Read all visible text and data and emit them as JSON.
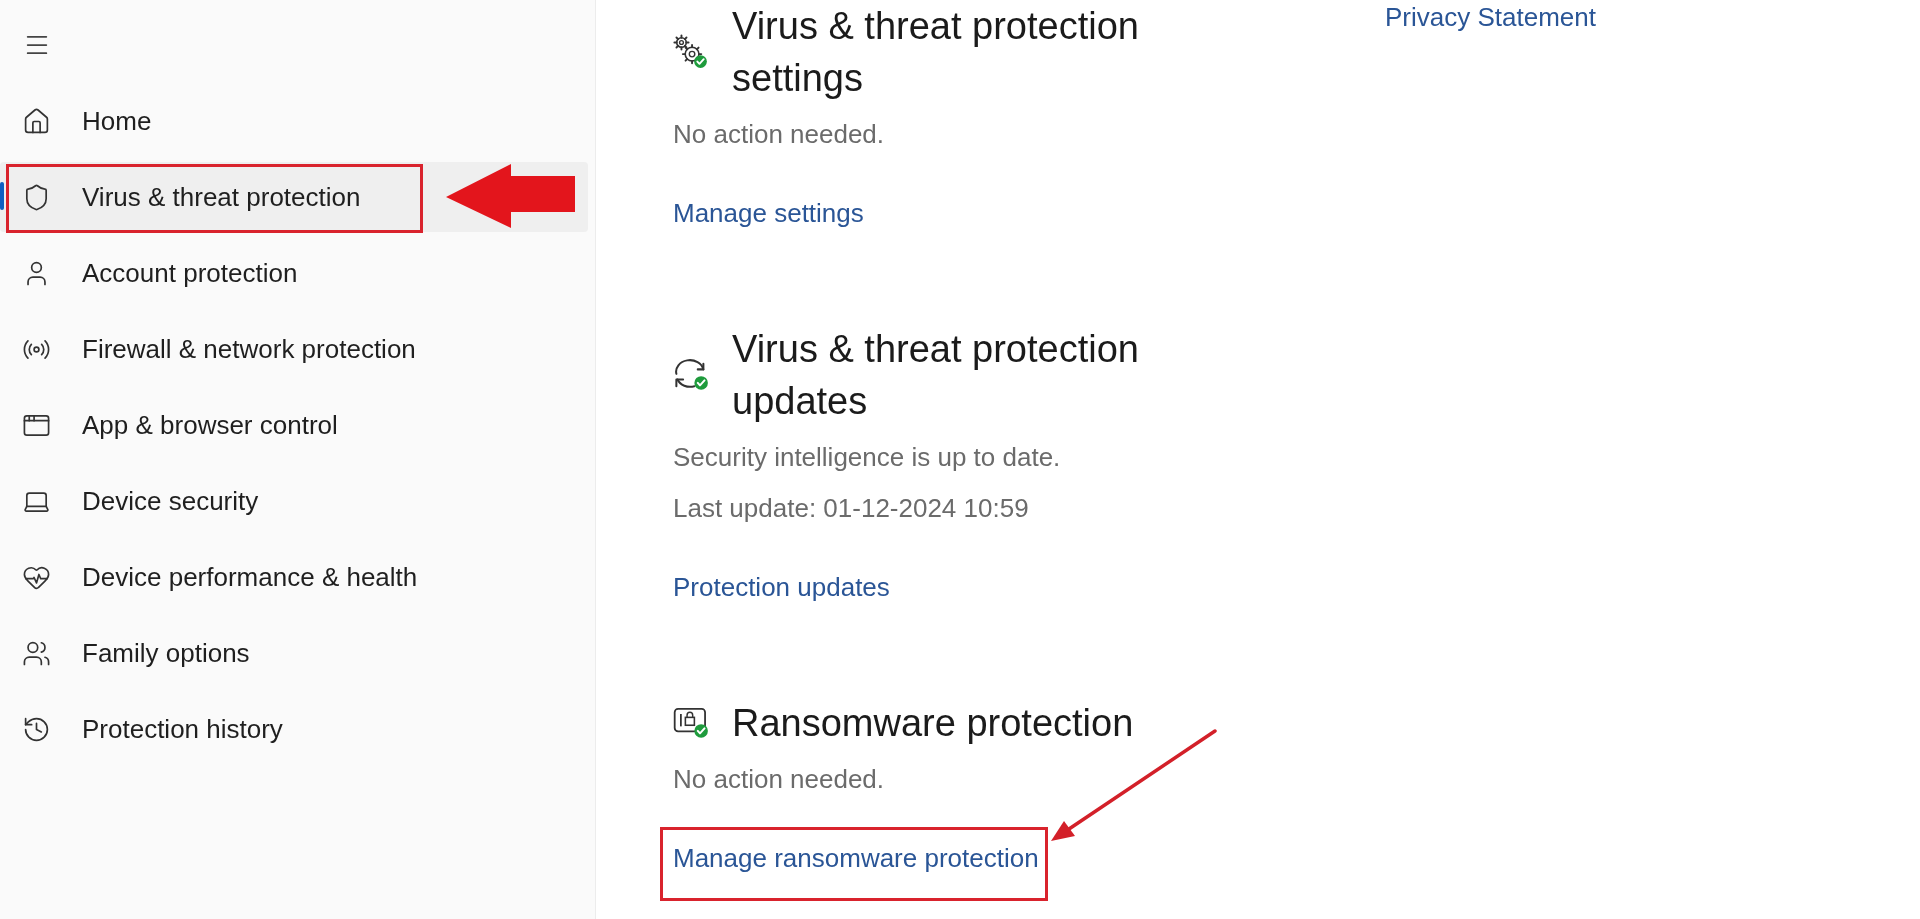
{
  "sidebar": {
    "items": [
      {
        "label": "Home",
        "selected": false,
        "annotated": false
      },
      {
        "label": "Virus & threat protection",
        "selected": true,
        "annotated": true
      },
      {
        "label": "Account protection",
        "selected": false,
        "annotated": false
      },
      {
        "label": "Firewall & network protection",
        "selected": false,
        "annotated": false
      },
      {
        "label": "App & browser control",
        "selected": false,
        "annotated": false
      },
      {
        "label": "Device security",
        "selected": false,
        "annotated": false
      },
      {
        "label": "Device performance & health",
        "selected": false,
        "annotated": false
      },
      {
        "label": "Family options",
        "selected": false,
        "annotated": false
      },
      {
        "label": "Protection history",
        "selected": false,
        "annotated": false
      }
    ]
  },
  "sections": [
    {
      "title": "Virus & threat protection settings",
      "status": [
        "No action needed."
      ],
      "link": {
        "label": "Manage settings",
        "annotated": false
      }
    },
    {
      "title": "Virus & threat protection updates",
      "status": [
        "Security intelligence is up to date.",
        "Last update: 01-12-2024 10:59"
      ],
      "link": {
        "label": "Protection updates",
        "annotated": false
      }
    },
    {
      "title": "Ransomware protection",
      "status": [
        "No action needed."
      ],
      "link": {
        "label": "Manage ransomware protection",
        "annotated": true
      }
    }
  ],
  "privacy_link": "Privacy Statement"
}
